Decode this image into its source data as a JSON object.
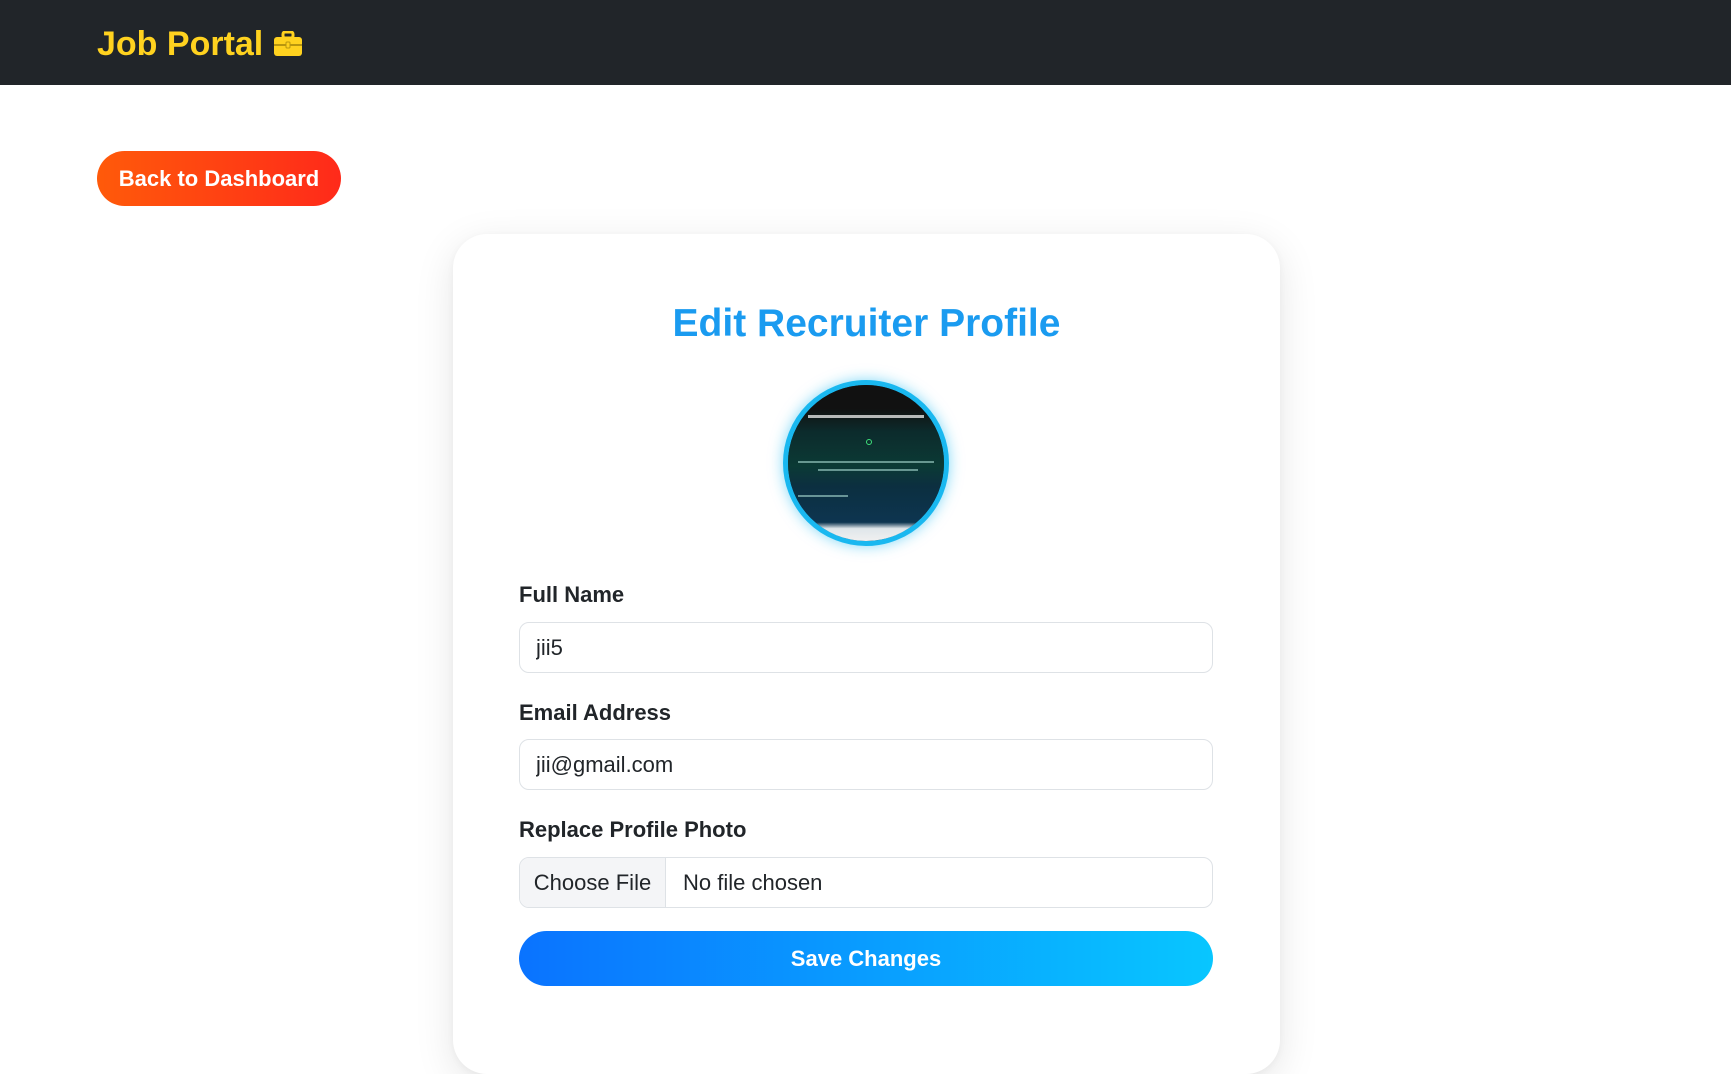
{
  "navbar": {
    "brand_label": "Job Portal",
    "brand_icon": "briefcase-icon",
    "background": "#212529",
    "brand_color": "#ffd21f"
  },
  "actions": {
    "back_label": "Back to Dashboard"
  },
  "card": {
    "title": "Edit Recruiter Profile",
    "title_color": "#1a9bf0"
  },
  "form": {
    "full_name": {
      "label": "Full Name",
      "value": "jii5"
    },
    "email": {
      "label": "Email Address",
      "value": "jii@gmail.com"
    },
    "photo": {
      "label": "Replace Profile Photo",
      "button_label": "Choose File",
      "status": "No file chosen"
    },
    "save_label": "Save Changes"
  }
}
